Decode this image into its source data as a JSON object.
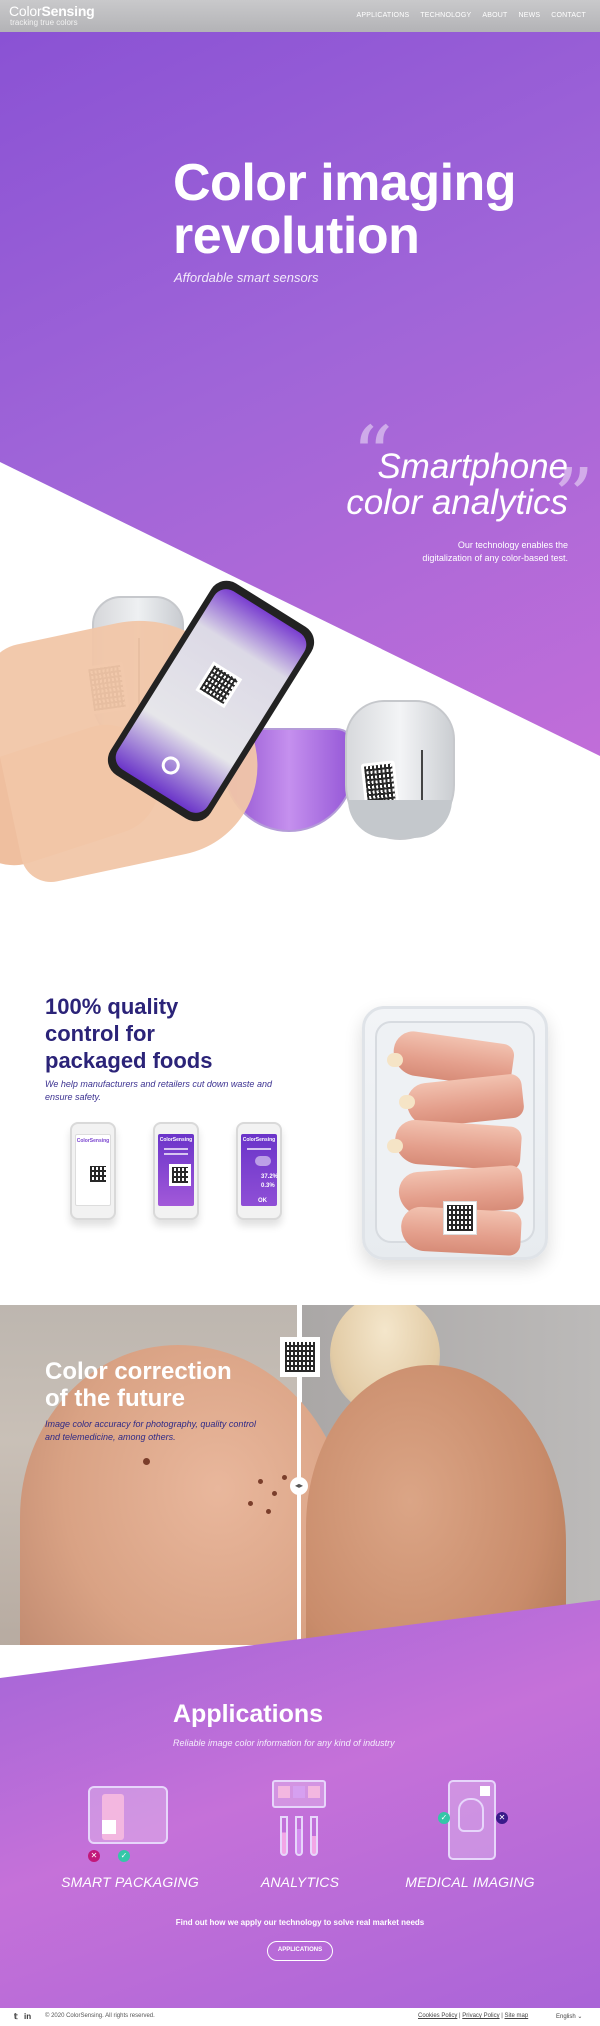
{
  "nav": {
    "logo_light": "Color",
    "logo_bold": "Sensing",
    "tagline": "tracking true colors",
    "links": [
      "APPLICATIONS",
      "TECHNOLOGY",
      "ABOUT",
      "NEWS",
      "CONTACT"
    ]
  },
  "hero": {
    "title_line1": "Color imaging",
    "title_line2": "revolution",
    "subtitle": "Affordable smart sensors"
  },
  "smartphone": {
    "title_line1": "Smartphone",
    "title_line2": "color analytics",
    "desc_line1": "Our technology enables the",
    "desc_line2": "digitalization of any color-based test."
  },
  "packaged_foods": {
    "title_line1": "100% quality",
    "title_line2": "control for",
    "title_line3": "packaged foods",
    "desc": "We help manufacturers and retailers cut down waste and ensure safety.",
    "phones": [
      {
        "brand": "ColorSensing",
        "mode": "scan"
      },
      {
        "brand": "ColorSensing",
        "mode": "reading"
      },
      {
        "brand": "ColorSensing",
        "mode": "result",
        "value1": "37.2%",
        "value2": "0.3%",
        "status": "OK"
      }
    ]
  },
  "color_correction": {
    "title_line1": "Color correction",
    "title_line2": "of the future",
    "desc": "Image color accuracy for photography, quality control and telemedicine, among others."
  },
  "applications": {
    "title": "Applications",
    "subtitle": "Reliable image color information for any kind of industry",
    "items": [
      {
        "label": "SMART PACKAGING",
        "icon": "smart-packaging-icon"
      },
      {
        "label": "ANALYTICS",
        "icon": "analytics-icon"
      },
      {
        "label": "MEDICAL IMAGING",
        "icon": "medical-imaging-icon"
      }
    ],
    "cta_text": "Find out how we apply our technology to solve real market needs",
    "cta_button": "APPLICATIONS"
  },
  "footer": {
    "social": [
      "twitter-icon",
      "linkedin-icon"
    ],
    "copyright": "© 2020 ColorSensing. All rights reserved.",
    "links": [
      "Cookies Policy",
      "Privacy Policy",
      "Site map"
    ],
    "language": "English"
  },
  "colors": {
    "brand_purple": "#8a52d4",
    "brand_pink": "#c36ed9",
    "dark_navy": "#2b2378",
    "teal": "#34c7a8"
  }
}
